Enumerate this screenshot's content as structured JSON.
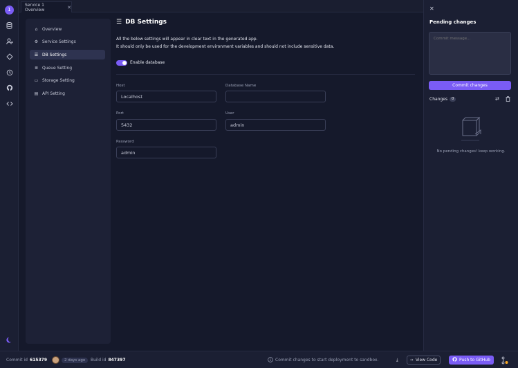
{
  "rail": {
    "logo_letter": "1",
    "icons": [
      "database-icon",
      "users-icon",
      "diamond-icon",
      "history-icon",
      "github-icon",
      "code-icon"
    ],
    "theme_icon": "moon-icon"
  },
  "tab": {
    "label": "Service 1 Overview",
    "close": "✕"
  },
  "sidebar": {
    "items": [
      {
        "label": "Overview",
        "icon": "⌂"
      },
      {
        "label": "Service Settings",
        "icon": "⚙"
      },
      {
        "label": "DB Settings",
        "icon": "☰"
      },
      {
        "label": "Queue Setting",
        "icon": "≣"
      },
      {
        "label": "Storage Setting",
        "icon": "▭"
      },
      {
        "label": "API Setting",
        "icon": "▤"
      }
    ],
    "active_index": 2
  },
  "main": {
    "title": "DB Settings",
    "title_icon": "☰",
    "desc_line1": "All the below settings will appear in clear text in the generated app.",
    "desc_line2": "It should only be used for the development environment variables and should not include sensitive data.",
    "toggle_label": "Enable database",
    "toggle_on": true,
    "fields": {
      "host": {
        "label": "Host",
        "value": "Localhost"
      },
      "dbname": {
        "label": "Database Name",
        "value": ""
      },
      "port": {
        "label": "Port",
        "value": "5432"
      },
      "user": {
        "label": "User",
        "value": "admin"
      },
      "password": {
        "label": "Password",
        "value": "admin"
      }
    }
  },
  "rpanel": {
    "close": "✕",
    "title": "Pending changes",
    "commit_placeholder": "Commit message...",
    "commit_button": "Commit changes",
    "changes_label": "Changes",
    "changes_count": "0",
    "empty_text": "No pending changes! keep working."
  },
  "statusbar": {
    "commit_label": "Commit id",
    "commit_id": "615379",
    "time": "2 days ago",
    "build_label": "Build id",
    "build_id": "847397",
    "info_text": "Commit changes to start deployment to sandbox.",
    "view_code": "View Code",
    "push": "Push to GitHub"
  },
  "colors": {
    "accent": "#7a5cf5",
    "bg": "#15192b",
    "panel": "#1d2136"
  }
}
